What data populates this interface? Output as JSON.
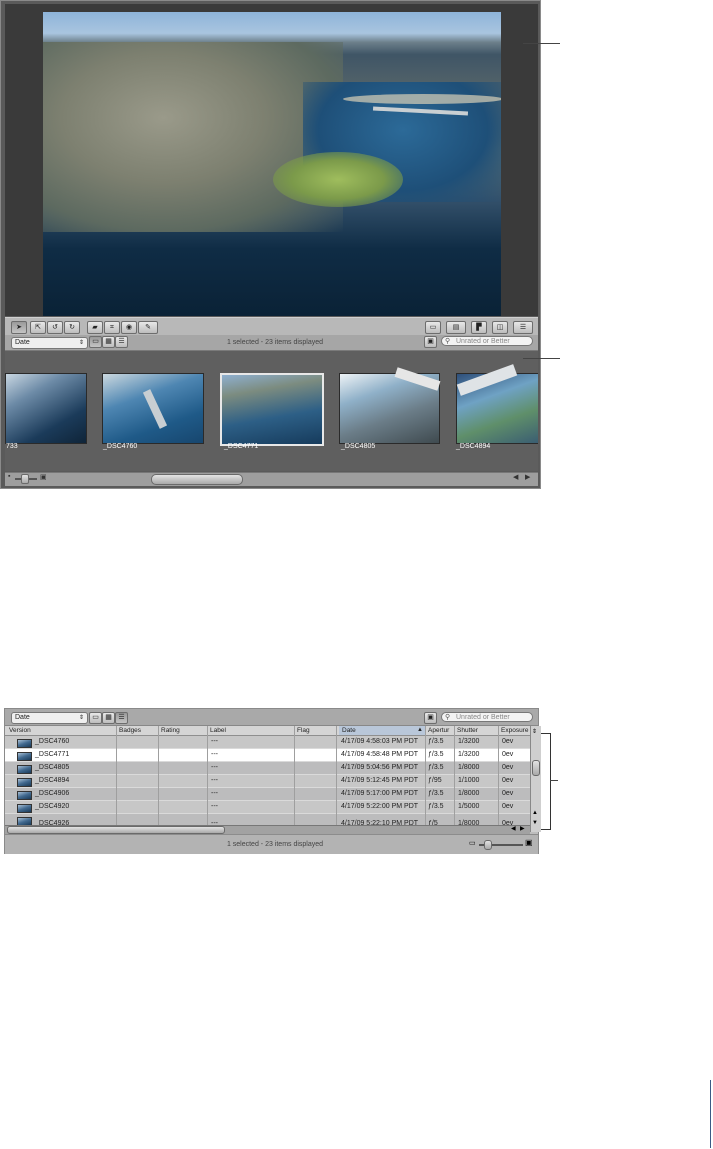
{
  "viewer": {
    "toolbar_icons": [
      "pointer-tool-icon",
      "lift-stamp-icon",
      "rotate-left-icon",
      "rotate-right-icon",
      "straighten-icon",
      "crop-icon",
      "red-eye-icon",
      "brush-icon"
    ],
    "layout_icons": [
      "viewer-mode-icon",
      "layout-icon",
      "thumbnail-icon",
      "split-view-icon",
      "filmstrip-icon"
    ]
  },
  "browser": {
    "sort_popup": "Date",
    "view_buttons": [
      "filmstrip-view-icon",
      "grid-view-icon",
      "list-view-icon"
    ],
    "status": "1 selected - 23 items displayed",
    "search_placeholder": "Unrated or Better",
    "thumbnails": [
      {
        "name": "733"
      },
      {
        "name": "_DSC4760"
      },
      {
        "name": "_DSC4771"
      },
      {
        "name": "_DSC4805"
      },
      {
        "name": "_DSC4894"
      }
    ],
    "selected_index": 2
  },
  "list_view": {
    "sort_popup": "Date",
    "search_placeholder": "Unrated or Better",
    "status": "1 selected - 23 items displayed",
    "columns": [
      "Version",
      "Badges",
      "Rating",
      "Label",
      "Flag",
      "Date",
      "Apertur",
      "Shutter",
      "Exposure"
    ],
    "rows": [
      {
        "version": "_DSC4760",
        "label": "---",
        "date": "4/17/09 4:58:03 PM PDT",
        "aperture": "ƒ/3.5",
        "shutter": "1/3200",
        "exposure": "0ev"
      },
      {
        "version": "_DSC4771",
        "label": "---",
        "date": "4/17/09 4:58:48 PM PDT",
        "aperture": "ƒ/3.5",
        "shutter": "1/3200",
        "exposure": "0ev"
      },
      {
        "version": "_DSC4805",
        "label": "---",
        "date": "4/17/09 5:04:56 PM PDT",
        "aperture": "ƒ/3.5",
        "shutter": "1/8000",
        "exposure": "0ev"
      },
      {
        "version": "_DSC4894",
        "label": "---",
        "date": "4/17/09 5:12:45 PM PDT",
        "aperture": "ƒ/95",
        "shutter": "1/1000",
        "exposure": "0ev"
      },
      {
        "version": "_DSC4906",
        "label": "---",
        "date": "4/17/09 5:17:00 PM PDT",
        "aperture": "ƒ/3.5",
        "shutter": "1/8000",
        "exposure": "0ev"
      },
      {
        "version": "_DSC4920",
        "label": "---",
        "date": "4/17/09 5:22:00 PM PDT",
        "aperture": "ƒ/3.5",
        "shutter": "1/5000",
        "exposure": "0ev"
      },
      {
        "version": "_DSC4926",
        "label": "---",
        "date": "4/17/09 5:22:10 PM PDT",
        "aperture": "ƒ/5",
        "shutter": "1/8000",
        "exposure": "0ev"
      }
    ],
    "selected_row": 1
  }
}
